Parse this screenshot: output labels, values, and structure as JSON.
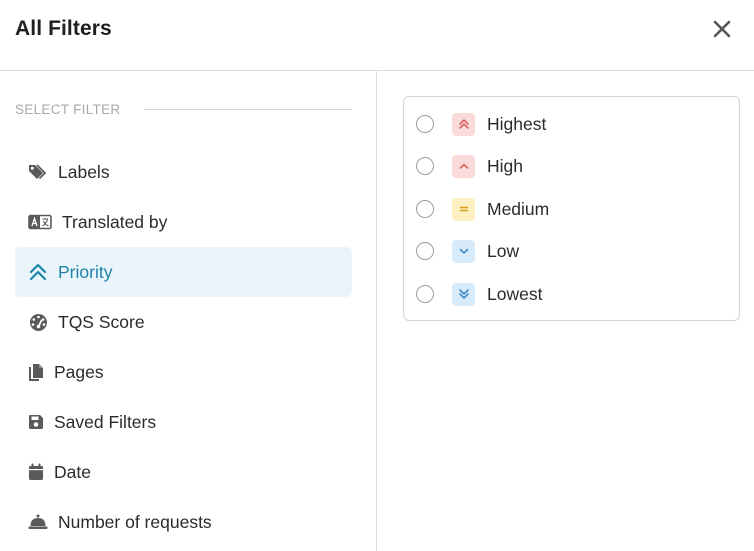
{
  "dialog": {
    "title": "All Filters",
    "close_icon": "close-icon"
  },
  "sidebar": {
    "section_label": "SELECT FILTER",
    "items": [
      {
        "label": "Labels",
        "icon": "tags-icon",
        "active": false
      },
      {
        "label": "Translated by",
        "icon": "translate-icon",
        "active": false
      },
      {
        "label": "Priority",
        "icon": "double-chevron-up-icon",
        "active": true
      },
      {
        "label": "TQS Score",
        "icon": "gauge-icon",
        "active": false
      },
      {
        "label": "Pages",
        "icon": "pages-icon",
        "active": false
      },
      {
        "label": "Saved Filters",
        "icon": "floppy-disk-icon",
        "active": false
      },
      {
        "label": "Date",
        "icon": "calendar-icon",
        "active": false
      },
      {
        "label": "Number of requests",
        "icon": "service-bell-icon",
        "active": false
      }
    ]
  },
  "priority_options": [
    {
      "label": "Highest",
      "icon": "double-chevron-up-icon",
      "color": "#d9534f",
      "bg": "#fbdada",
      "selected": false
    },
    {
      "label": "High",
      "icon": "chevron-up-icon",
      "color": "#d9534f",
      "bg": "#fbdada",
      "selected": false
    },
    {
      "label": "Medium",
      "icon": "equals-icon",
      "color": "#d4a017",
      "bg": "#fdf0c2",
      "selected": false
    },
    {
      "label": "Low",
      "icon": "chevron-down-icon",
      "color": "#2f7fc1",
      "bg": "#d8ebfa",
      "selected": false
    },
    {
      "label": "Lowest",
      "icon": "double-chevron-down-icon",
      "color": "#2f7fc1",
      "bg": "#d8ebfa",
      "selected": false
    }
  ],
  "colors": {
    "accent": "#1f84a8",
    "active_bg": "#e9f4fb",
    "icon_gray": "#5a5a5a"
  }
}
